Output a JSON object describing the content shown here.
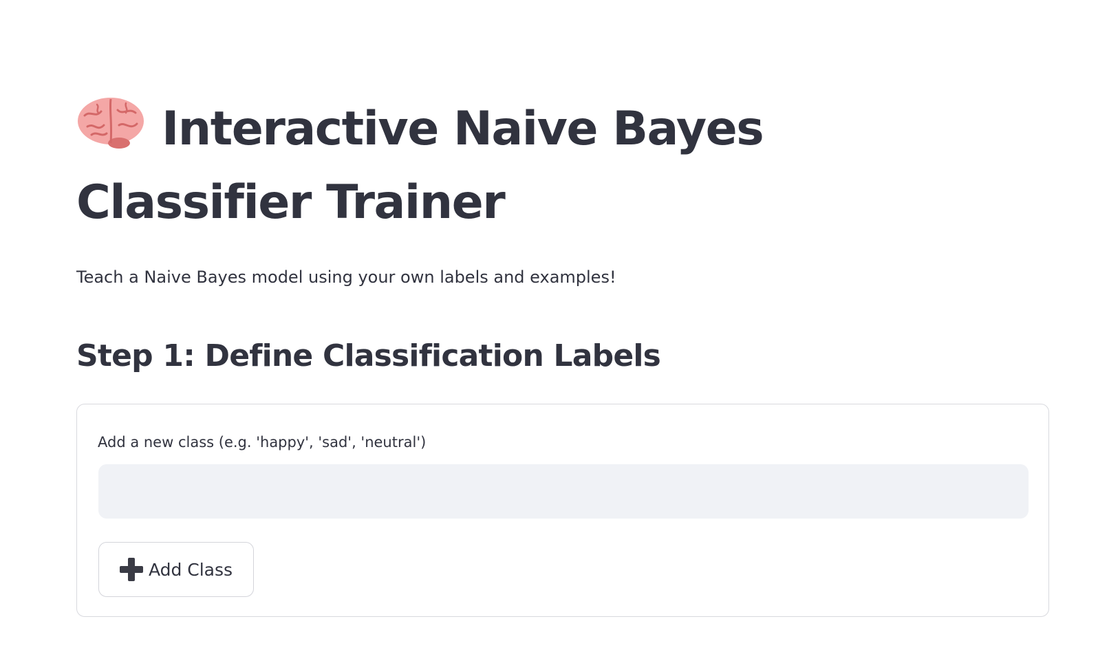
{
  "header": {
    "icon": "brain-icon",
    "title": "Interactive Naive Bayes Classifier Trainer",
    "subtitle": "Teach a Naive Bayes model using your own labels and examples!"
  },
  "step1": {
    "heading": "Step 1: Define Classification Labels",
    "form": {
      "field_label": "Add a new class (e.g. 'happy', 'sad', 'neutral')",
      "field_value": "",
      "button_icon": "plus-icon",
      "button_label": "Add Class"
    }
  },
  "colors": {
    "text": "#31333f",
    "input_background": "#f0f2f6",
    "border": "#d8d9de",
    "background": "#ffffff"
  }
}
